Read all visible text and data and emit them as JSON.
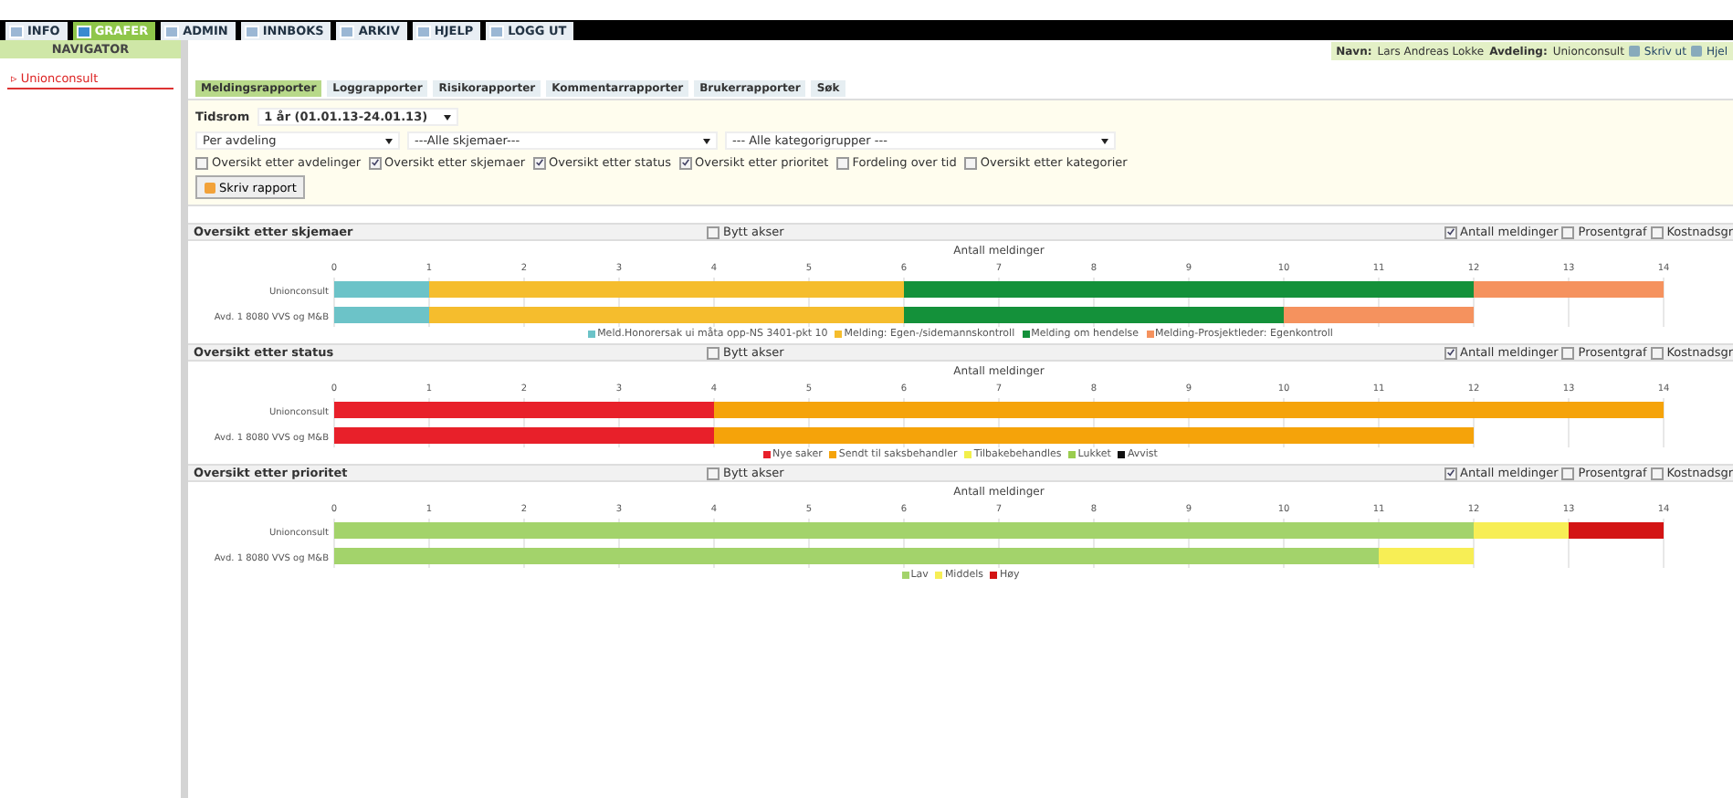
{
  "top_tabs": [
    {
      "label": "INFO",
      "selected": false
    },
    {
      "label": "GRAFER",
      "selected": true
    },
    {
      "label": "ADMIN",
      "selected": false
    },
    {
      "label": "INNBOKS",
      "selected": false
    },
    {
      "label": "ARKIV",
      "selected": false
    },
    {
      "label": "HJELP",
      "selected": false
    },
    {
      "label": "LOGG UT",
      "selected": false
    }
  ],
  "navigator": {
    "title": "NAVIGATOR",
    "items": [
      {
        "marker": "▹",
        "label": "Unionconsult",
        "selected": true
      }
    ]
  },
  "user_bar": {
    "name_label": "Navn:",
    "name": "Lars Andreas Lokke",
    "department_label": "Avdeling:",
    "department": "Unionconsult",
    "links": [
      "Skriv ut",
      "Hjel"
    ]
  },
  "report_tabs": [
    {
      "label": "Meldingsrapporter",
      "selected": true
    },
    {
      "label": "Loggrapporter",
      "selected": false
    },
    {
      "label": "Risikorapporter",
      "selected": false
    },
    {
      "label": "Kommentarrapporter",
      "selected": false
    },
    {
      "label": "Brukerrapporter",
      "selected": false
    },
    {
      "label": "Søk",
      "selected": false
    }
  ],
  "filters": {
    "period_label": "Tidsrom",
    "period_value": "1 år (01.01.13-24.01.13)",
    "dropdowns": [
      "Per avdeling",
      "---Alle skjemaer---",
      "--- Alle kategorigrupper ---"
    ],
    "checkboxes": [
      {
        "label": "Oversikt etter avdelinger",
        "checked": false
      },
      {
        "label": "Oversikt etter skjemaer",
        "checked": true
      },
      {
        "label": "Oversikt etter status",
        "checked": true
      },
      {
        "label": "Oversikt etter prioritet",
        "checked": true
      },
      {
        "label": "Fordeling over tid",
        "checked": false
      },
      {
        "label": "Oversikt etter kategorier",
        "checked": false
      }
    ],
    "button": "Skriv rapport"
  },
  "sections": [
    {
      "title": "Oversikt etter skjemaer",
      "swap_axes": {
        "label": "Bytt akser",
        "checked": false
      },
      "options": [
        {
          "label": "Antall meldinger",
          "checked": true
        },
        {
          "label": "Prosentgraf",
          "checked": false
        },
        {
          "label": "Kostnadsgr",
          "checked": false
        }
      ],
      "chart_data": {
        "type": "bar",
        "orientation": "horizontal",
        "stacked": true,
        "grid": true,
        "legend": true,
        "xlabel": "Antall meldinger",
        "categories": [
          "Unionconsult",
          "Avd. 1 8080 VVS og M&B"
        ],
        "xlim": [
          0,
          14
        ],
        "xticks": [
          0,
          1,
          2,
          3,
          4,
          5,
          6,
          7,
          8,
          9,
          10,
          11,
          12,
          13,
          14
        ],
        "series": [
          {
            "name": "Meld.Honorersak ui måta opp-NS 3401-pkt 10",
            "color": "#6cc3c8",
            "values": [
              1,
              1
            ]
          },
          {
            "name": "Melding: Egen-/sidemannskontroll",
            "color": "#f5bd2d",
            "values": [
              5,
              5
            ]
          },
          {
            "name": "Melding om hendelse",
            "color": "#14913a",
            "values": [
              6,
              4
            ]
          },
          {
            "name": "Melding-Prosjektleder: Egenkontroll",
            "color": "#f5925e",
            "values": [
              2,
              2
            ]
          }
        ]
      }
    },
    {
      "title": "Oversikt etter status",
      "swap_axes": {
        "label": "Bytt akser",
        "checked": false
      },
      "options": [
        {
          "label": "Antall meldinger",
          "checked": true
        },
        {
          "label": "Prosentgraf",
          "checked": false
        },
        {
          "label": "Kostnadsgr",
          "checked": false
        }
      ],
      "chart_data": {
        "type": "bar",
        "orientation": "horizontal",
        "stacked": true,
        "grid": true,
        "legend": true,
        "xlabel": "Antall meldinger",
        "categories": [
          "Unionconsult",
          "Avd. 1 8080 VVS og M&B"
        ],
        "xlim": [
          0,
          14
        ],
        "xticks": [
          0,
          1,
          2,
          3,
          4,
          5,
          6,
          7,
          8,
          9,
          10,
          11,
          12,
          13,
          14
        ],
        "series": [
          {
            "name": "Nye saker",
            "color": "#e8202a",
            "values": [
              4,
              4
            ]
          },
          {
            "name": "Sendt til saksbehandler",
            "color": "#f5a30a",
            "values": [
              10,
              8
            ]
          },
          {
            "name": "Tilbakebehandles",
            "color": "#f2ef4a",
            "values": [
              0,
              0
            ]
          },
          {
            "name": "Lukket",
            "color": "#9acd4e",
            "values": [
              0,
              0
            ]
          },
          {
            "name": "Avvist",
            "color": "#111111",
            "values": [
              0,
              0
            ]
          }
        ]
      }
    },
    {
      "title": "Oversikt etter prioritet",
      "swap_axes": {
        "label": "Bytt akser",
        "checked": false
      },
      "options": [
        {
          "label": "Antall meldinger",
          "checked": true
        },
        {
          "label": "Prosentgraf",
          "checked": false
        },
        {
          "label": "Kostnadsgr",
          "checked": false
        }
      ],
      "chart_data": {
        "type": "bar",
        "orientation": "horizontal",
        "stacked": true,
        "grid": true,
        "legend": true,
        "xlabel": "Antall meldinger",
        "categories": [
          "Unionconsult",
          "Avd. 1 8080 VVS og M&B"
        ],
        "xlim": [
          0,
          14
        ],
        "xticks": [
          0,
          1,
          2,
          3,
          4,
          5,
          6,
          7,
          8,
          9,
          10,
          11,
          12,
          13,
          14
        ],
        "series": [
          {
            "name": "Lav",
            "color": "#a3d36b",
            "values": [
              12,
              11
            ]
          },
          {
            "name": "Middels",
            "color": "#f7ee55",
            "values": [
              1,
              1
            ]
          },
          {
            "name": "Høy",
            "color": "#d31414",
            "values": [
              1,
              0
            ]
          }
        ]
      }
    }
  ]
}
